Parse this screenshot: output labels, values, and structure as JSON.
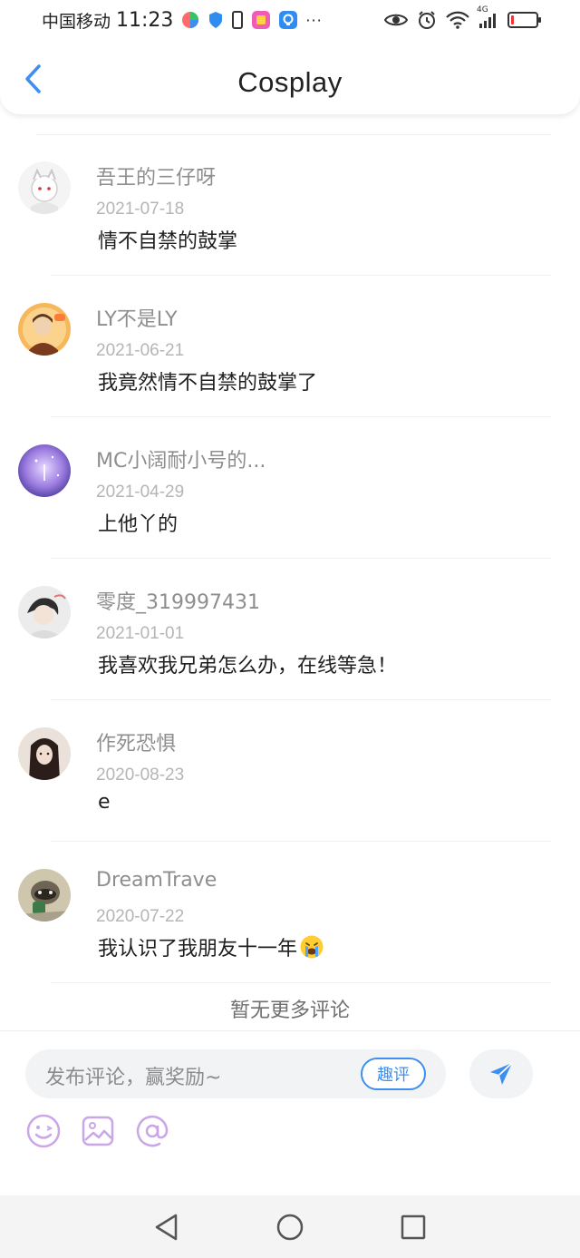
{
  "status_bar": {
    "carrier": "中国移动",
    "time": "11:23",
    "more": "···",
    "network": "4G",
    "battery_level": 0.12,
    "battery_color": "#e53935"
  },
  "header": {
    "title": "Cosplay",
    "back_icon": "chevron-left-icon",
    "accent": "#3d8ef0"
  },
  "comments": [
    {
      "user": "吾王的三仔呀",
      "date": "2021-07-18",
      "text": "情不自禁的鼓掌",
      "avatar_colors": [
        "#f3f3f3",
        "#cfcfcf"
      ]
    },
    {
      "user": "LY不是LY",
      "date": "2021-06-21",
      "text": "我竟然情不自禁的鼓掌了",
      "avatar_colors": [
        "#f5a623",
        "#5a3a22"
      ]
    },
    {
      "user": "MC小阔耐小号的...",
      "date": "2021-04-29",
      "text": "上他丫的",
      "avatar_colors": [
        "#b79be8",
        "#4b3c9a"
      ]
    },
    {
      "user": "零度_319997431",
      "date": "2021-01-01",
      "text": "我喜欢我兄弟怎么办，在线等急！",
      "avatar_colors": [
        "#e8e8e8",
        "#3a3a3a"
      ]
    },
    {
      "user": "作死恐惧",
      "date": "2020-08-23",
      "text": "e",
      "avatar_colors": [
        "#d9d0c9",
        "#3b2a24"
      ]
    },
    {
      "user": "DreamTrave",
      "date": "2020-07-22",
      "text": "我认识了我朋友十一年",
      "text_emoji": "crying-face-icon",
      "avatar_colors": [
        "#c8c0a8",
        "#4a5b3a"
      ]
    }
  ],
  "no_more": "暂无更多评论",
  "composer": {
    "placeholder": "发布评论，赢奖励~",
    "qupin_label": "趣评",
    "send_icon": "send-icon",
    "tools": [
      "smiley-icon",
      "image-icon",
      "at-icon"
    ],
    "tool_color": "#c9a6e8"
  },
  "nav_bar": {
    "buttons": [
      "back-triangle-icon",
      "home-circle-icon",
      "recents-square-icon"
    ]
  }
}
